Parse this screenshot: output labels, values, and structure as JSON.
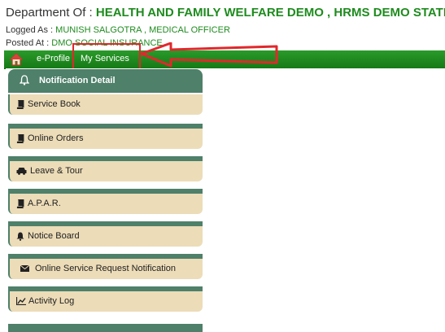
{
  "header": {
    "dept_prefix": "Department Of : ",
    "dept_name": "HEALTH AND FAMILY WELFARE DEMO , HRMS DEMO STATE",
    "logged_label": "Logged As : ",
    "logged_value": "MUNISH SALGOTRA , MEDICAL OFFICER",
    "posted_label": "Posted At : ",
    "posted_value": "DMO SOCIAL INSURANCE"
  },
  "navbar": {
    "home_icon": "home-icon",
    "items": [
      {
        "label": "e-Profile"
      },
      {
        "label": "My Services"
      }
    ]
  },
  "sidebar": {
    "header": {
      "label": "Notification Detail",
      "icon": "bell-icon"
    },
    "items": [
      {
        "label": "Service Book",
        "icon": "book-icon"
      },
      {
        "label": "Online Orders",
        "icon": "book-icon"
      },
      {
        "label": "Leave & Tour",
        "icon": "car-icon"
      },
      {
        "label": "A.P.A.R.",
        "icon": "book-icon"
      },
      {
        "label": "Notice Board",
        "icon": "bell-icon"
      },
      {
        "label": "Online Service Request Notification",
        "icon": "envelope-icon"
      },
      {
        "label": "Activity Log",
        "icon": "chart-icon"
      }
    ]
  },
  "colors": {
    "nav_green": "#1e8b1e",
    "sidebar_green": "#4e806a",
    "item_beige": "#ecdcb8",
    "annotation_red": "#e0282c"
  }
}
